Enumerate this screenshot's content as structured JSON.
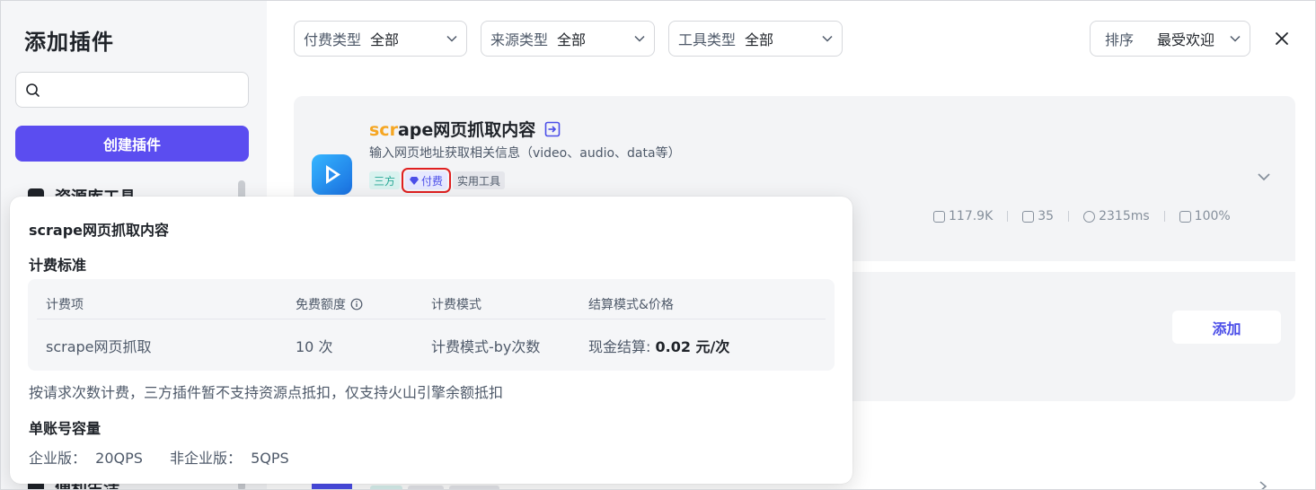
{
  "sidebar": {
    "title": "添加插件",
    "search": {
      "placeholder": ""
    },
    "create_button": "创建插件",
    "items": [
      {
        "label": "资源库工具",
        "icon": "users-icon"
      },
      {
        "label": "便利生活",
        "icon": "cup-icon"
      }
    ]
  },
  "filters": [
    {
      "label": "付费类型",
      "value": "全部"
    },
    {
      "label": "来源类型",
      "value": "全部"
    },
    {
      "label": "工具类型",
      "value": "全部"
    }
  ],
  "sort": {
    "label": "排序",
    "value": "最受欢迎"
  },
  "plugin": {
    "title_highlight": "scr",
    "title_rest": "ape网页抓取内容",
    "description": "输入网页地址获取相关信息（video、audio、data等）",
    "tags": {
      "third_party": "三方",
      "paid": "付费",
      "category": "实用工具"
    },
    "stats": {
      "runs": "117.9K",
      "bots": "35",
      "latency": "2315ms",
      "success": "100%"
    },
    "add_button": "添加"
  },
  "popover": {
    "title": "scrape网页抓取内容",
    "billing_heading": "计费标准",
    "table": {
      "headers": [
        "计费项",
        "免费额度",
        "计费模式",
        "结算模式&价格"
      ],
      "row": {
        "item": "scrape网页抓取",
        "free_quota": "10 次",
        "mode": "计费模式-by次数",
        "settle_label": "现金结算:",
        "settle_price": "0.02 元/次"
      }
    },
    "note": "按请求次数计费，三方插件暂不支持资源点抵扣，仅支持火山引擎余额抵扣",
    "capacity_heading": "单账号容量",
    "enterprise": "企业版：  20QPS",
    "non_enterprise": "非企业版：  5QPS"
  },
  "colors": {
    "accent": "#5b4df0",
    "highlight": "#f5a623",
    "paid_outline": "#e02020"
  }
}
